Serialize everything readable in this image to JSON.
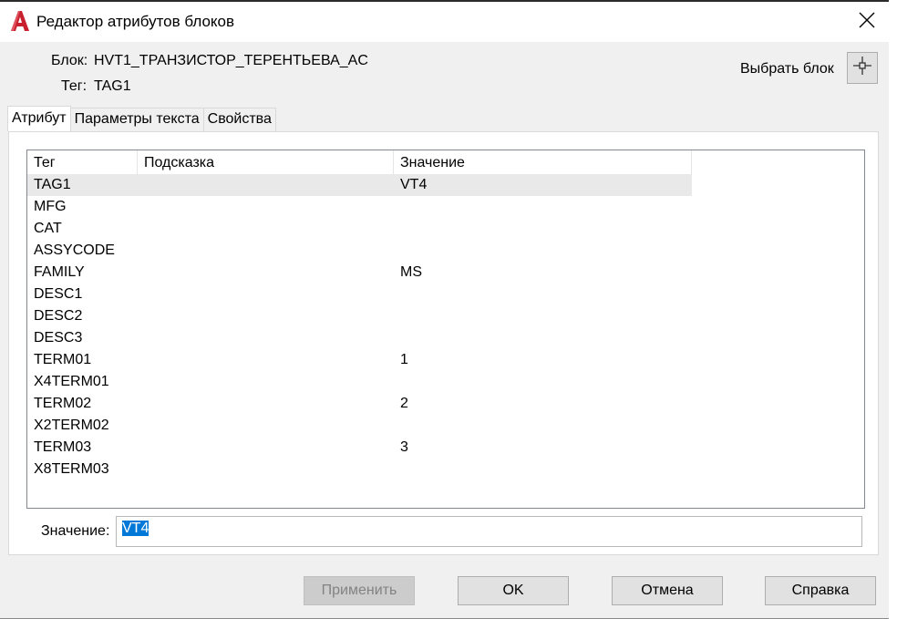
{
  "window": {
    "title": "Редактор атрибутов блоков"
  },
  "info": {
    "block_label": "Блок:",
    "block_value": "HVT1_ТРАНЗИСТОР_ТЕРЕНТЬЕВА_AC",
    "tag_label": "Тег:",
    "tag_value": "TAG1",
    "pick_block_label": "Выбрать блок"
  },
  "tabs": [
    {
      "label": "Атрибут",
      "active": true
    },
    {
      "label": "Параметры текста",
      "active": false
    },
    {
      "label": "Свойства",
      "active": false
    }
  ],
  "table": {
    "columns": [
      "Тег",
      "Подсказка",
      "Значение"
    ],
    "rows": [
      {
        "tag": "TAG1",
        "prompt": "",
        "value": "VT4",
        "selected": true
      },
      {
        "tag": "MFG",
        "prompt": "",
        "value": ""
      },
      {
        "tag": "CAT",
        "prompt": "",
        "value": ""
      },
      {
        "tag": "ASSYCODE",
        "prompt": "",
        "value": ""
      },
      {
        "tag": "FAMILY",
        "prompt": "",
        "value": "MS"
      },
      {
        "tag": "DESC1",
        "prompt": "",
        "value": ""
      },
      {
        "tag": "DESC2",
        "prompt": "",
        "value": ""
      },
      {
        "tag": "DESC3",
        "prompt": "",
        "value": ""
      },
      {
        "tag": "TERM01",
        "prompt": "",
        "value": "1"
      },
      {
        "tag": "X4TERM01",
        "prompt": "",
        "value": ""
      },
      {
        "tag": "TERM02",
        "prompt": "",
        "value": "2"
      },
      {
        "tag": "X2TERM02",
        "prompt": "",
        "value": ""
      },
      {
        "tag": "TERM03",
        "prompt": "",
        "value": "3"
      },
      {
        "tag": "X8TERM03",
        "prompt": "",
        "value": ""
      }
    ]
  },
  "value_field": {
    "label": "Значение:",
    "value": "VT4"
  },
  "buttons": {
    "apply": "Применить",
    "ok": "OK",
    "cancel": "Отмена",
    "help": "Справка"
  },
  "colors": {
    "accent_selection": "#0078d7",
    "autocad_red": "#c8202f",
    "row_selected": "#e9e9e9"
  },
  "icons": {
    "app": "autocad-logo-icon",
    "close": "close-icon",
    "pick": "pick-crosshair-icon"
  }
}
